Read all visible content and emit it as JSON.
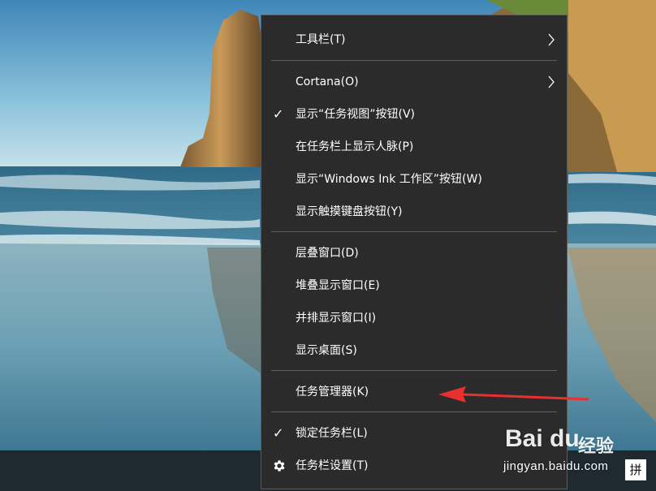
{
  "menu": {
    "items": [
      {
        "label": "工具栏(T)",
        "has_submenu": true,
        "checked": false
      },
      {
        "label": "Cortana(O)",
        "has_submenu": true,
        "checked": false
      },
      {
        "label": "显示“任务视图”按钮(V)",
        "has_submenu": false,
        "checked": true
      },
      {
        "label": "在任务栏上显示人脉(P)",
        "has_submenu": false,
        "checked": false
      },
      {
        "label": "显示“Windows Ink 工作区”按钮(W)",
        "has_submenu": false,
        "checked": false
      },
      {
        "label": "显示触摸键盘按钮(Y)",
        "has_submenu": false,
        "checked": false
      },
      {
        "label": "层叠窗口(D)",
        "has_submenu": false,
        "checked": false
      },
      {
        "label": "堆叠显示窗口(E)",
        "has_submenu": false,
        "checked": false
      },
      {
        "label": "并排显示窗口(I)",
        "has_submenu": false,
        "checked": false
      },
      {
        "label": "显示桌面(S)",
        "has_submenu": false,
        "checked": false
      },
      {
        "label": "任务管理器(K)",
        "has_submenu": false,
        "checked": false
      },
      {
        "label": "锁定任务栏(L)",
        "has_submenu": false,
        "checked": true
      },
      {
        "label": "任务栏设置(T)",
        "has_submenu": false,
        "checked": false,
        "icon": "gear-icon"
      }
    ],
    "check_glyph": "✓"
  },
  "taskbar": {
    "ime_label": "拼"
  },
  "watermark": {
    "logo": "Bai du",
    "logo_cn": "经验",
    "url": "jingyan.baidu.com"
  },
  "colors": {
    "menu_bg": "#2b2b2b",
    "menu_border": "#5a5a5a",
    "separator": "#5e5e5e",
    "arrow": "#e8312f",
    "taskbar": "#1e2a30"
  }
}
